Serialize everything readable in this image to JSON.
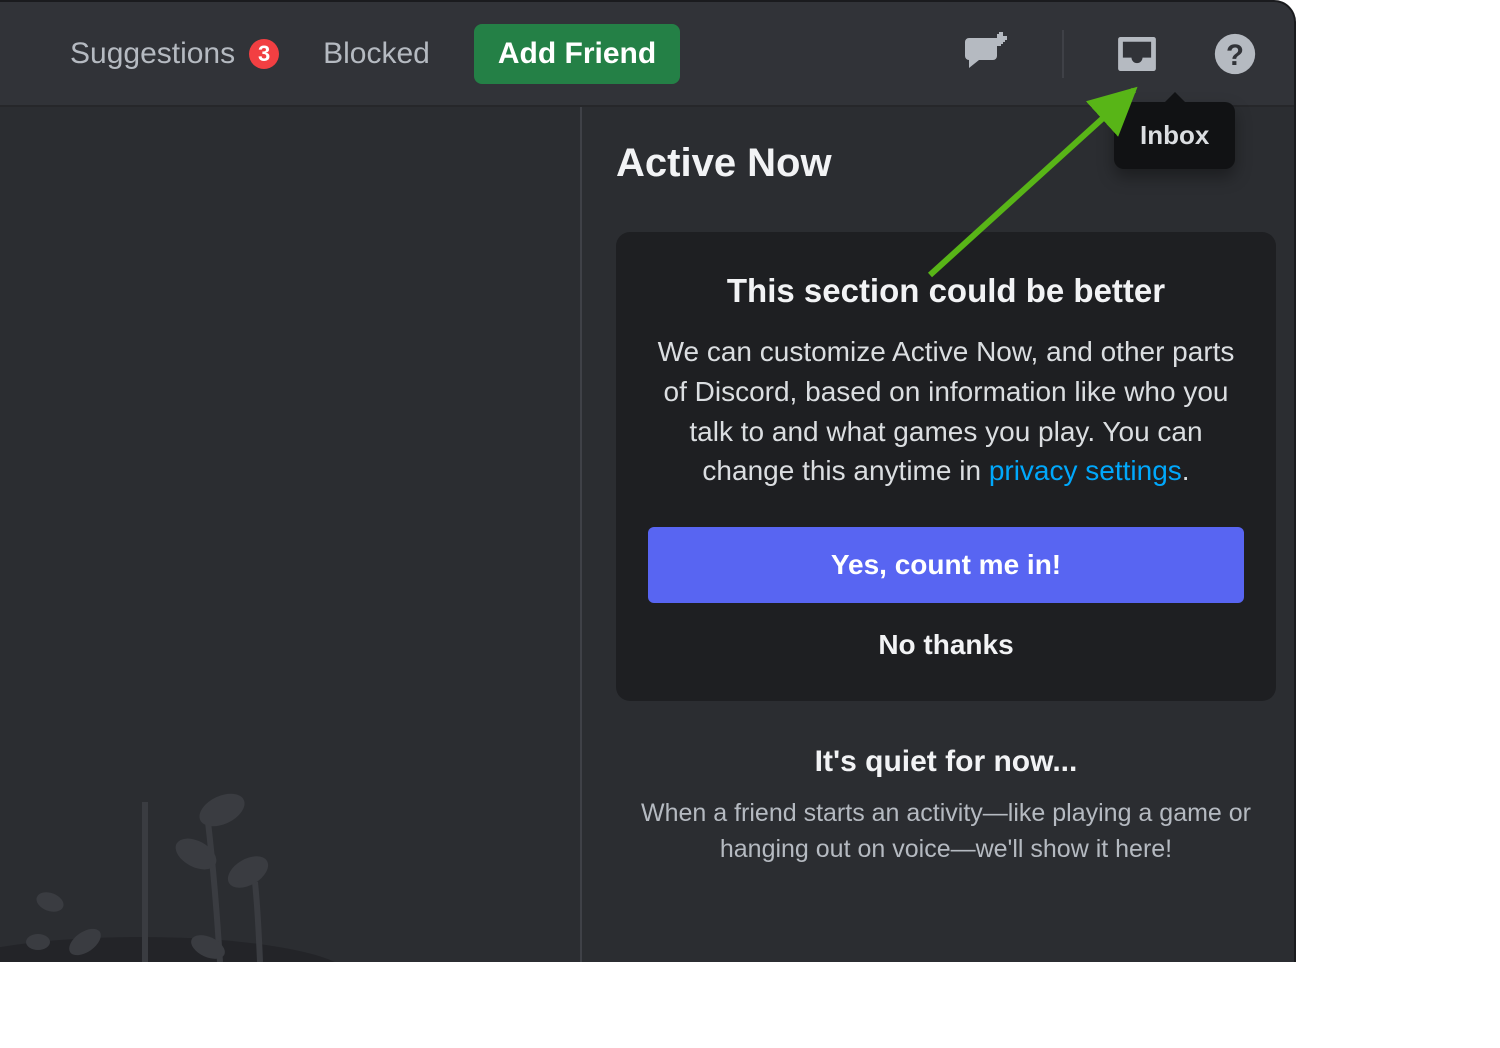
{
  "tabs": {
    "suggestions": {
      "label": "Suggestions",
      "badge": "3"
    },
    "blocked": {
      "label": "Blocked"
    },
    "add_friend": {
      "label": "Add Friend"
    }
  },
  "toolbar_icons": [
    "new-group-dm",
    "inbox",
    "help"
  ],
  "tooltip": {
    "label": "Inbox"
  },
  "active_now": {
    "title": "Active Now",
    "card": {
      "heading": "This section could be better",
      "body_before_link": "We can customize Active Now, and other parts of Discord, based on information like who you talk to and what games you play. You can change this anytime in ",
      "link_text": "privacy settings",
      "body_after_link": ".",
      "primary_btn": "Yes, count me in!",
      "secondary_btn": "No thanks"
    },
    "quiet": {
      "title": "It's quiet for now...",
      "body": "When a friend starts an activity—like playing a game or hanging out on voice—we'll show it here!"
    }
  }
}
